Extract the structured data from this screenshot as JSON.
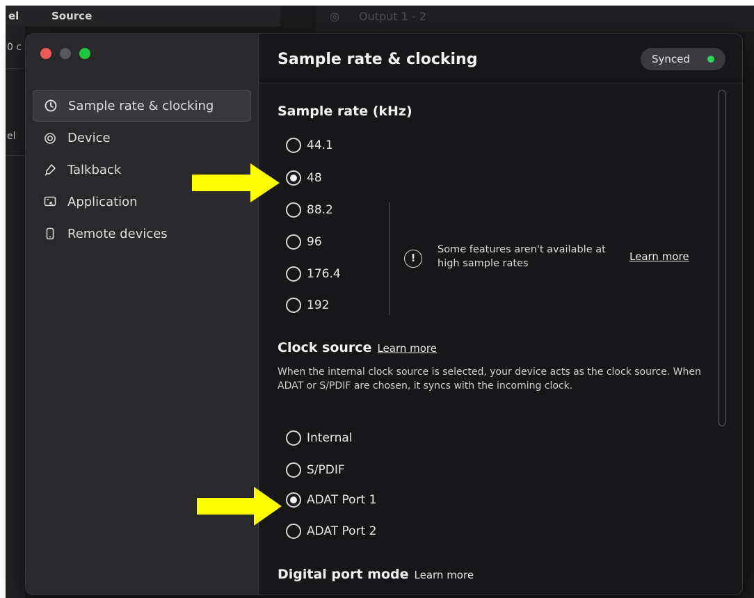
{
  "background": {
    "header_left_partial": "el",
    "header_source": "Source",
    "row_partial_1": "0 c",
    "row_partial_2": "el",
    "output_label": "Output 1 - 2"
  },
  "window": {
    "title": "Sample rate & clocking",
    "status": "Synced",
    "status_color": "#2fd15a"
  },
  "sidebar": {
    "items": [
      {
        "label": "Sample rate & clocking",
        "icon": "clock-icon",
        "active": true
      },
      {
        "label": "Device",
        "icon": "device-icon",
        "active": false
      },
      {
        "label": "Talkback",
        "icon": "microphone-icon",
        "active": false
      },
      {
        "label": "Application",
        "icon": "application-icon",
        "active": false
      },
      {
        "label": "Remote devices",
        "icon": "phone-icon",
        "active": false
      }
    ]
  },
  "sample_rate": {
    "heading": "Sample rate (kHz)",
    "options": [
      "44.1",
      "48",
      "88.2",
      "96",
      "176.4",
      "192"
    ],
    "selected": "48",
    "notice": "Some features aren't available at high sample rates",
    "notice_learn": "Learn more"
  },
  "clock_source": {
    "heading": "Clock source",
    "learn": "Learn more",
    "description": "When the internal clock source is selected, your device acts as the clock source. When ADAT or S/PDIF are chosen, it syncs with the incoming clock.",
    "options": [
      "Internal",
      "S/PDIF",
      "ADAT Port 1",
      "ADAT Port 2"
    ],
    "selected": "ADAT Port 1"
  },
  "digital_port": {
    "heading": "Digital port mode",
    "learn": "Learn more"
  },
  "annotations": {
    "arrow_color": "#ffff00"
  }
}
